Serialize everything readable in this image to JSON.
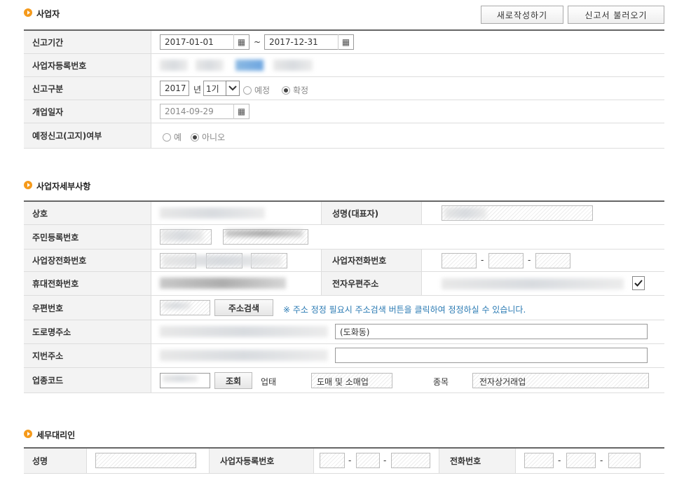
{
  "sections": {
    "business": "사업자",
    "business_detail": "사업자세부사항",
    "tax_agent": "세무대리인"
  },
  "buttons": {
    "new_write": "새로작성하기",
    "load_report": "신고서 불러오기",
    "address_search": "주소검색",
    "lookup": "조회"
  },
  "business": {
    "labels": {
      "period": "신고기간",
      "reg_no": "사업자등록번호",
      "report_type": "신고구분",
      "open_date": "개업일자",
      "pre_report": "예정신고(고지)여부"
    },
    "period_start": "2017-01-01",
    "period_sep": "~",
    "period_end": "2017-12-31",
    "year": "2017",
    "year_unit": "년",
    "term": "1기",
    "opt_planned": "예정",
    "opt_final": "확정",
    "open_date": "2014-09-29",
    "opt_yes": "예",
    "opt_no": "아니오"
  },
  "detail": {
    "labels": {
      "company": "상호",
      "name": "성명(대표자)",
      "resident_no": "주민등록번호",
      "workplace_phone": "사업장전화번호",
      "business_phone": "사업자전화번호",
      "mobile": "휴대전화번호",
      "email": "전자우편주소",
      "postal": "우편번호",
      "road_address": "도로명주소",
      "lot_address": "지번주소",
      "industry_code": "업종코드",
      "business_type": "업태",
      "item": "종목"
    },
    "postal_note": "※ 주소 정정 필요시 주소검색 버튼을 클릭하여 정정하실 수 있습니다.",
    "road_address_suffix": "(도화동)",
    "business_type_value": "도매 및 소매업",
    "item_value": "전자상거래업",
    "dash": "-"
  },
  "agent": {
    "labels": {
      "name": "성명",
      "reg_no": "사업자등록번호",
      "phone": "전화번호"
    }
  }
}
